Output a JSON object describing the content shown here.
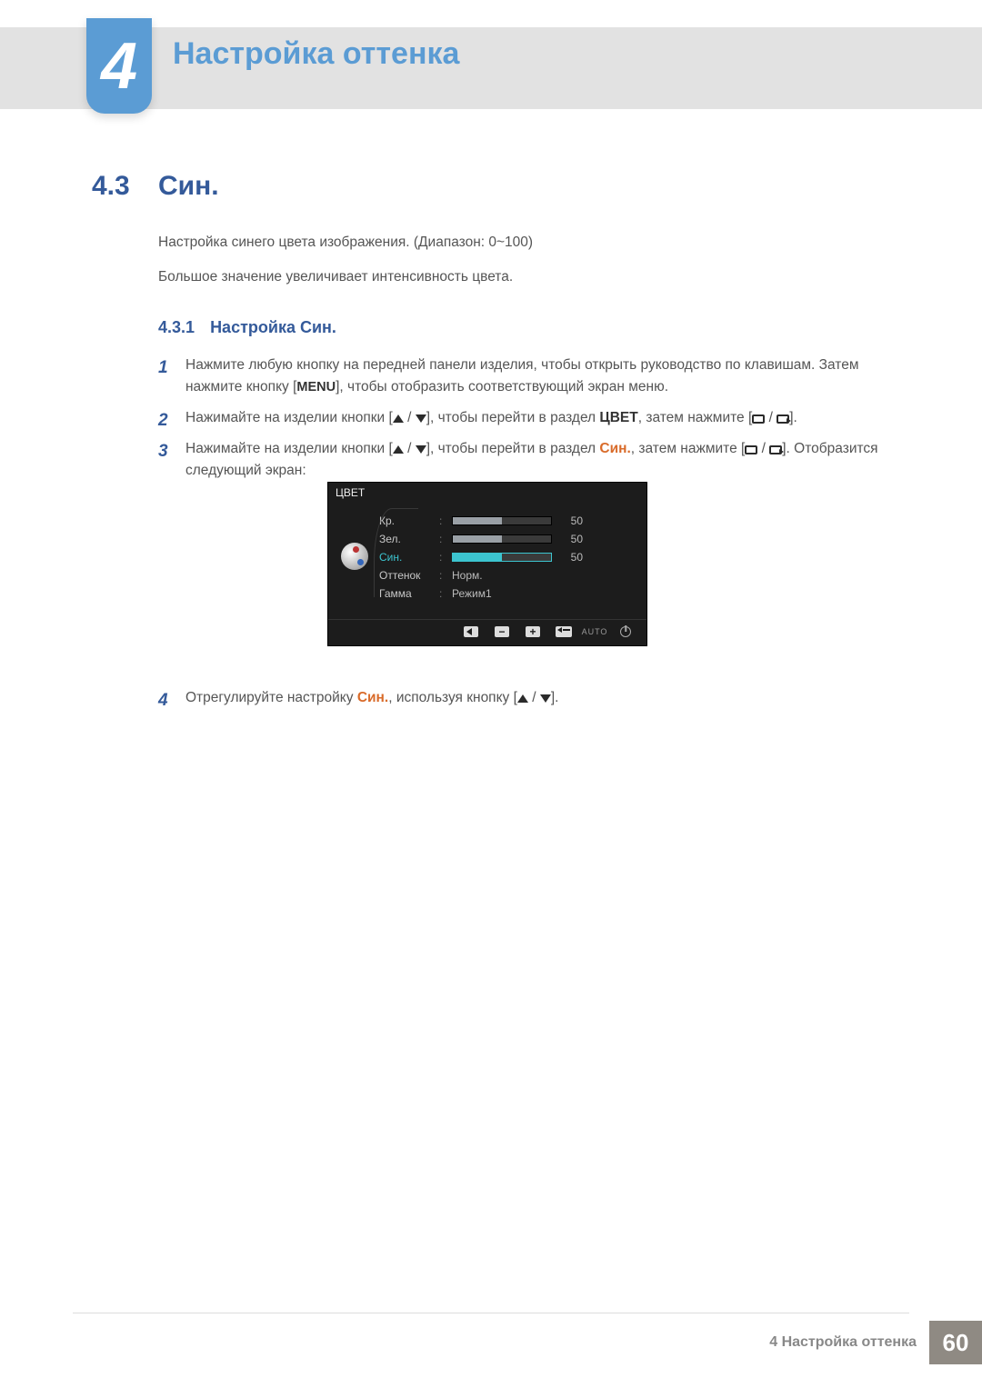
{
  "chapter": {
    "number": "4",
    "title": "Настройка оттенка"
  },
  "section": {
    "number": "4.3",
    "title": "Син."
  },
  "description": {
    "line1": "Настройка синего цвета изображения. (Диапазон: 0~100)",
    "line2": "Большое значение увеличивает интенсивность цвета."
  },
  "subsection": {
    "number": "4.3.1",
    "title": "Настройка Син."
  },
  "steps": {
    "s1": {
      "num": "1",
      "text_a": "Нажмите любую кнопку на передней панели изделия, чтобы открыть руководство по клавишам. Затем нажмите кнопку [",
      "menu": "MENU",
      "text_b": "], чтобы отобразить соответствующий экран меню."
    },
    "s2": {
      "num": "2",
      "text_a": "Нажимайте на изделии кнопки [",
      "text_b": "], чтобы перейти в раздел ",
      "kw": "ЦВЕТ",
      "text_c": ", затем нажмите [",
      "text_d": "]."
    },
    "s3": {
      "num": "3",
      "text_a": "Нажимайте на изделии кнопки [",
      "text_b": "], чтобы перейти в раздел ",
      "kw": "Син.",
      "text_c": ", затем нажмите [",
      "text_d": "]. Отобразится следующий экран:"
    },
    "s4": {
      "num": "4",
      "text_a": "Отрегулируйте настройку ",
      "kw": "Син.",
      "text_b": ", используя кнопку [",
      "text_c": "]."
    }
  },
  "osd": {
    "title": "ЦВЕТ",
    "rows": {
      "r1": {
        "label": "Кр.",
        "value": "50",
        "fill_pct": 50
      },
      "r2": {
        "label": "Зел.",
        "value": "50",
        "fill_pct": 50
      },
      "r3": {
        "label": "Син.",
        "value": "50",
        "fill_pct": 50,
        "selected": true
      },
      "r4": {
        "label": "Оттенок",
        "text": "Норм."
      },
      "r5": {
        "label": "Гамма",
        "text": "Режим1"
      }
    },
    "footer": {
      "auto": "AUTO"
    }
  },
  "chart_data": {
    "type": "table",
    "title": "ЦВЕТ",
    "rows": [
      {
        "label": "Кр.",
        "value": 50,
        "range": [
          0,
          100
        ]
      },
      {
        "label": "Зел.",
        "value": 50,
        "range": [
          0,
          100
        ]
      },
      {
        "label": "Син.",
        "value": 50,
        "range": [
          0,
          100
        ],
        "selected": true
      },
      {
        "label": "Оттенок",
        "value": "Норм."
      },
      {
        "label": "Гамма",
        "value": "Режим1"
      }
    ]
  },
  "footer": {
    "text": "4 Настройка оттенка",
    "page": "60"
  }
}
